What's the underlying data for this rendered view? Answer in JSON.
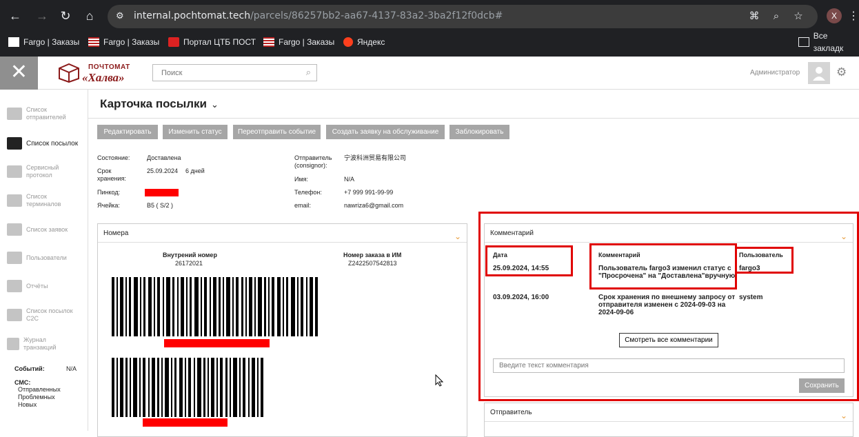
{
  "browser": {
    "url_host": "internal.pochtomat.tech",
    "url_path": "/parcels/86257bb2-aa67-4137-83a2-3ba2f12f0dcb#",
    "profile_initial": "X",
    "bookmarks": [
      "Fargo | Заказы",
      "Fargo | Заказы",
      "Портал ЦТБ ПОСТ",
      "Fargo | Заказы",
      "Яндекс"
    ],
    "all_bookmarks": "Все закладк"
  },
  "header": {
    "logo_top": "ПОЧТОМАТ",
    "logo_bottom": "«Халва»",
    "search_placeholder": "Поиск",
    "user_role": "Администратор"
  },
  "sidebar": {
    "items": [
      {
        "label": "Список отправителей",
        "icon": "truck-icon"
      },
      {
        "label": "Список посылок",
        "icon": "box-icon"
      },
      {
        "label": "Сервисный протокол",
        "icon": "list-icon"
      },
      {
        "label": "Список терминалов",
        "icon": "terminal-icon"
      },
      {
        "label": "Список заявок",
        "icon": "send-icon"
      },
      {
        "label": "Пользователи",
        "icon": "users-icon"
      },
      {
        "label": "Отчёты",
        "icon": "report-icon"
      },
      {
        "label": "Список посылок C2C",
        "icon": "box-c2c-icon"
      },
      {
        "label": "Журнал транзакций",
        "icon": "ruble-icon"
      }
    ],
    "events_label": "Событий:",
    "events_value": "N/A",
    "sms_label": "СМС:",
    "sms_sent": "Отправленных",
    "sms_problem": "Проблемных",
    "sms_new": "Новых"
  },
  "page": {
    "title": "Карточка посылки",
    "actions": [
      "Редактировать",
      "Изменить статус",
      "Переотправить событие",
      "Создать заявку на обслуживание",
      "Заблокировать"
    ]
  },
  "details": {
    "state_label": "Состояние:",
    "state_value": "Доставлена",
    "storage_label": "Срок хранения:",
    "storage_value": "25.09.2024",
    "storage_days": "6 дней",
    "pin_label": "Пинкод:",
    "cell_label": "Ячейка:",
    "cell_value": "B5 ( S/2 )",
    "sender_label": "Отправитель (consignor):",
    "sender_value": "宁波科洲贸易有限公司",
    "name_label": "Имя:",
    "name_value": "N/A",
    "phone_label": "Телефон:",
    "phone_value": "+7 999 991-99-99",
    "email_label": "email:",
    "email_value": "nawriza6@gmail.com"
  },
  "numbers_panel": {
    "title": "Номера",
    "internal_label": "Внутрений номер",
    "internal_value": "26172021",
    "order_label": "Номер заказа в ИМ",
    "order_value": "Z2422507542813"
  },
  "comments_panel": {
    "title": "Комментарий",
    "col_date": "Дата",
    "col_comment": "Комментарий",
    "col_user": "Пользователь",
    "rows": [
      {
        "date": "25.09.2024, 14:55",
        "comment": "Пользователь fargo3 изменил статус с \"Просрочена\" на \"Доставлена\"вручную",
        "user": "fargo3"
      },
      {
        "date": "03.09.2024, 16:00",
        "comment": "Срок хранения по внешнему запросу от отправителя изменен с 2024-09-03 на 2024-09-06",
        "user": "system"
      }
    ],
    "view_all": "Смотреть все комментарии",
    "input_placeholder": "Введите текст комментария",
    "save": "Сохранить"
  },
  "sender_panel": {
    "title": "Отправитель"
  },
  "colors": {
    "highlight": "#e00000",
    "redact": "#ff0000",
    "accent_chevron": "#e89d3c",
    "button_gray": "#a6a6a6"
  }
}
